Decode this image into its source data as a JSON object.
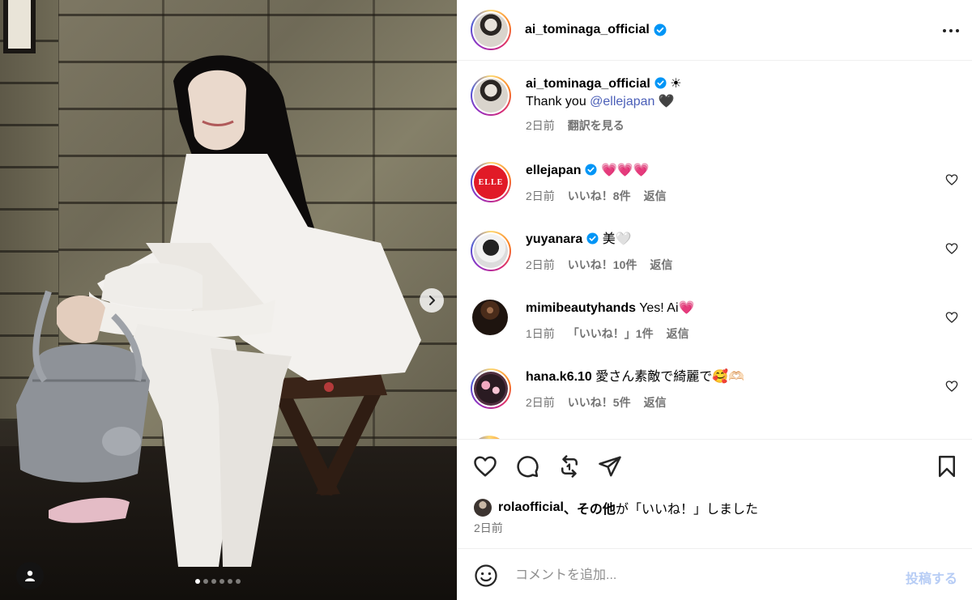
{
  "post": {
    "media": {
      "image_alt": "Woman in white lace outfit seated on wooden stool with silver handbag",
      "carousel_count": 6,
      "carousel_active_index": 0,
      "next_icon": "chevron-right-icon",
      "tag_icon": "user-tag-icon"
    },
    "header": {
      "username": "ai_tominaga_official",
      "verified_icon": "verified-badge-icon",
      "more_icon": "more-options-icon"
    },
    "caption": {
      "username": "ai_tominaga_official",
      "emoji": "☀",
      "text_prefix": "Thank you ",
      "mention": "@ellejapan",
      "text_suffix": " 🖤",
      "time": "2日前",
      "translate_label": "翻訳を見る"
    },
    "comments": [
      {
        "username": "ellejapan",
        "verified": true,
        "text": "💗💗💗",
        "time": "2日前",
        "likes": "いいね！8件",
        "reply": "返信",
        "avatar_label": "ELLE"
      },
      {
        "username": "yuyanara",
        "verified": true,
        "text": "美🤍",
        "time": "2日前",
        "likes": "いいね！10件",
        "reply": "返信"
      },
      {
        "username": "mimibeautyhands",
        "verified": false,
        "text": "Yes! Ai💗",
        "time": "1日前",
        "likes": "「いいね！」1件",
        "reply": "返信"
      },
      {
        "username": "hana.k6.10",
        "verified": false,
        "text": "愛さん素敵で綺麗で🥰🫶🏻",
        "time": "2日前",
        "likes": "いいね！5件",
        "reply": "返信"
      }
    ],
    "actions": {
      "like_icon": "heart-icon",
      "comment_icon": "comment-icon",
      "repost_icon": "repost-icon",
      "share_icon": "send-icon",
      "save_icon": "bookmark-icon"
    },
    "likes_summary": {
      "user": "rolaofficial",
      "sep": "、",
      "others": "その他",
      "suffix_1": "が",
      "suffix_2": "「いいね！」しました"
    },
    "posted_time": "2日前",
    "comment_box": {
      "placeholder": "コメントを追加...",
      "post_label": "投稿する",
      "emoji_icon": "emoji-icon"
    },
    "colors": {
      "verified": "#0095f6",
      "mention": "#4b5fb8",
      "muted_text": "#737373",
      "post_button_disabled": "#b6ccf5"
    }
  }
}
